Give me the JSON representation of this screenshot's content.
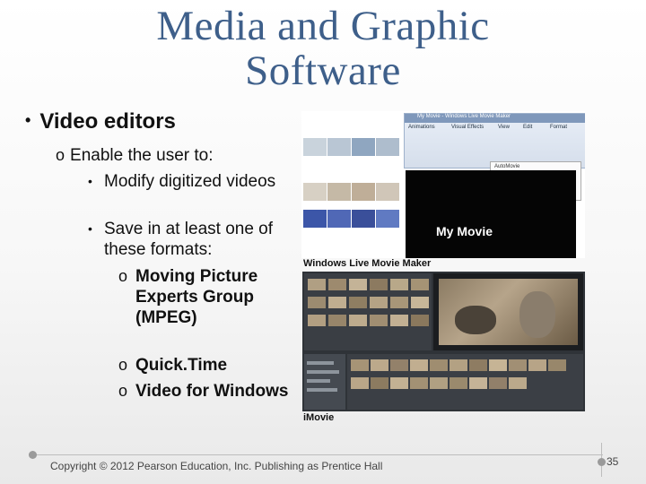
{
  "slide": {
    "title_line1": "Media and Graphic",
    "title_line2": "Software",
    "bullet1": "Video editors",
    "bullet2": "Enable the user to:",
    "bullet3a": "Modify digitized videos",
    "bullet3b": "Save in at least one of these formats:",
    "format1": "Moving Picture Experts Group (MPEG)",
    "format2": "Quick.Time",
    "format3": "Video for Windows",
    "bullet_level1": "•",
    "bullet_level2": "o",
    "bullet_level3": "•",
    "bullet_level4": "o"
  },
  "images": {
    "wlmm_caption": "Windows Live Movie Maker",
    "wlmm_window_title": "My Movie - Windows Live Movie Maker",
    "wlmm_tabs": [
      "Animations",
      "Visual Effects",
      "View",
      "Edit",
      "Format"
    ],
    "wlmm_tooltip": "AutoMovie",
    "wlmm_preview_text": "My Movie",
    "imovie_caption": "iMovie"
  },
  "footer": {
    "copyright": "Copyright © 2012 Pearson Education, Inc. Publishing as Prentice Hall",
    "page_number": "35"
  }
}
